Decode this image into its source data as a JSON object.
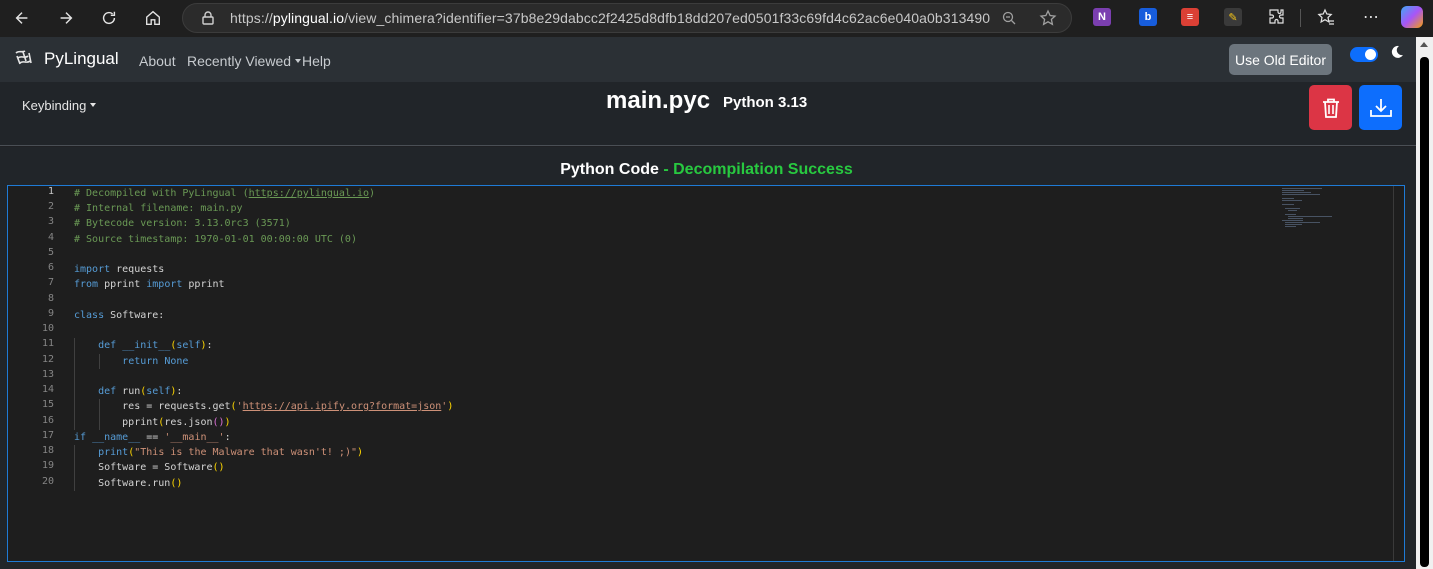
{
  "browser": {
    "url_prefix": "https://",
    "url_domain": "pylingual.io",
    "url_path": "/view_chimera?identifier=37b8e29dabcc2f2425d8dfb18dd207ed0501f33c69fd4c62ac6e040a0b313490",
    "extensions": [
      {
        "name": "onenote",
        "label": "N",
        "color": "#7b3fb0"
      },
      {
        "name": "bitwarden",
        "label": "b",
        "color": "#175ddc"
      },
      {
        "name": "todoist",
        "label": "≡",
        "color": "#db4035"
      },
      {
        "name": "color-picker",
        "label": "✎",
        "color": "#3a3a3a"
      },
      {
        "name": "extensions",
        "label": "⧉",
        "color": "transparent"
      }
    ]
  },
  "nav": {
    "brand": "PyLingual",
    "links": {
      "about": "About",
      "recent": "Recently Viewed",
      "help": "Help"
    },
    "old_editor": "Use Old Editor"
  },
  "header": {
    "keybinding": "Keybinding",
    "file_title": "main.pyc",
    "python_version": "Python 3.13"
  },
  "code_panel": {
    "heading": "Python Code",
    "separator": " - ",
    "status": "Decompilation Success",
    "status_color": "#28c940",
    "line_numbers": [
      "1",
      "2",
      "3",
      "4",
      "5",
      "6",
      "7",
      "8",
      "9",
      "10",
      "11",
      "12",
      "13",
      "14",
      "15",
      "16",
      "17",
      "18",
      "19",
      "20"
    ]
  }
}
